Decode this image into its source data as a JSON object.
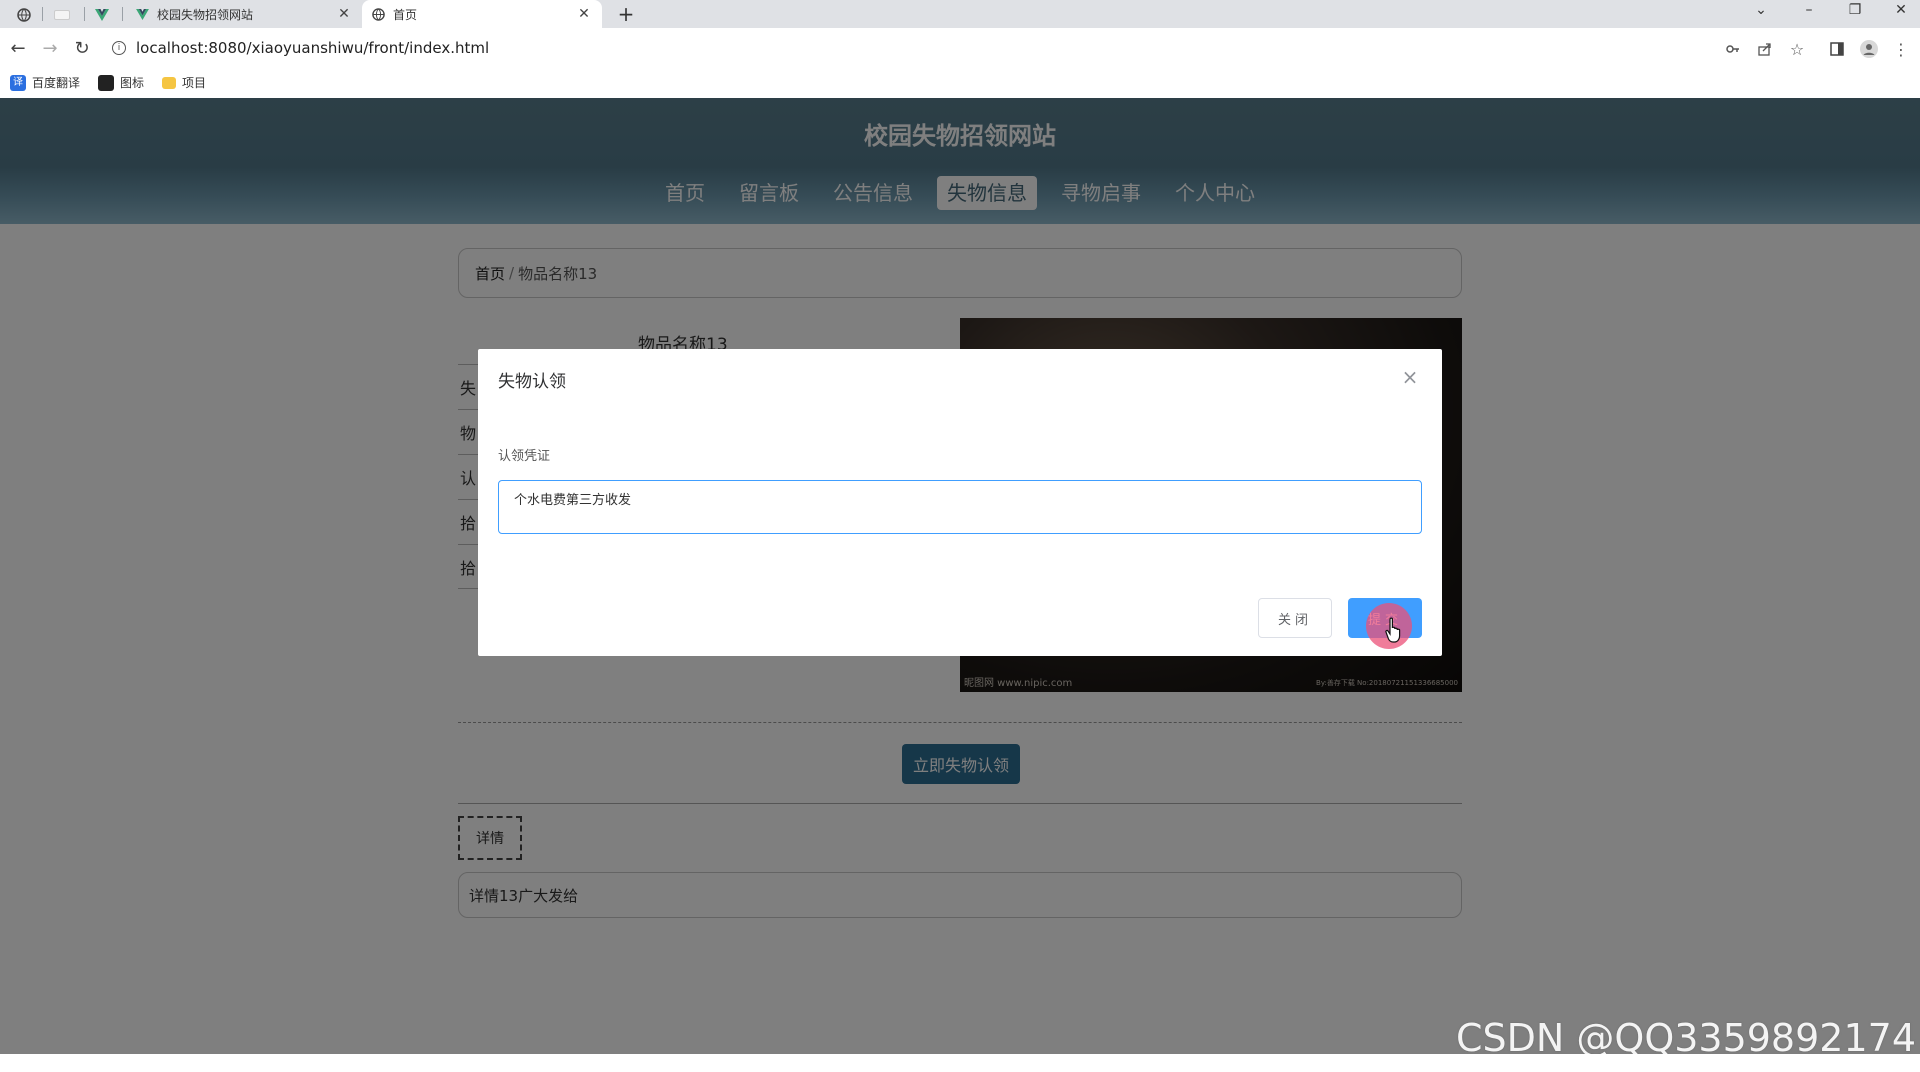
{
  "browser": {
    "tabs": [
      {
        "title": "校园失物招领网站"
      },
      {
        "title": "首页"
      }
    ],
    "url": "localhost:8080/xiaoyuanshiwu/front/index.html",
    "bookmarks": [
      {
        "label": "百度翻译"
      },
      {
        "label": "图标"
      },
      {
        "label": "项目"
      }
    ]
  },
  "site": {
    "title": "校园失物招领网站",
    "menu": [
      {
        "label": "首页"
      },
      {
        "label": "留言板"
      },
      {
        "label": "公告信息"
      },
      {
        "label": "失物信息"
      },
      {
        "label": "寻物启事"
      },
      {
        "label": "个人中心"
      }
    ],
    "active_menu": "失物信息"
  },
  "breadcrumb": {
    "home": "首页",
    "separator": "/",
    "current": "物品名称13"
  },
  "item": {
    "name": "物品名称13",
    "rows_visible_prefix": [
      "失",
      "物",
      "认",
      "拾",
      "拾"
    ],
    "photo_watermark_left": "昵图网 www.nipic.com",
    "photo_watermark_right": "By:善存下载 No:20180721151336685000",
    "claim_button": "立即失物认领",
    "details_tab": "详情",
    "details_text": "详情13广大发给"
  },
  "modal": {
    "title": "失物认领",
    "field_label": "认领凭证",
    "field_value": "个水电费第三方收发",
    "close_button": "关闭",
    "submit_button": "提交"
  },
  "watermark": "CSDN @QQ3359892174",
  "colors": {
    "header": "#52798b",
    "primary": "#409eff",
    "claim_button": "#2d6f93"
  }
}
